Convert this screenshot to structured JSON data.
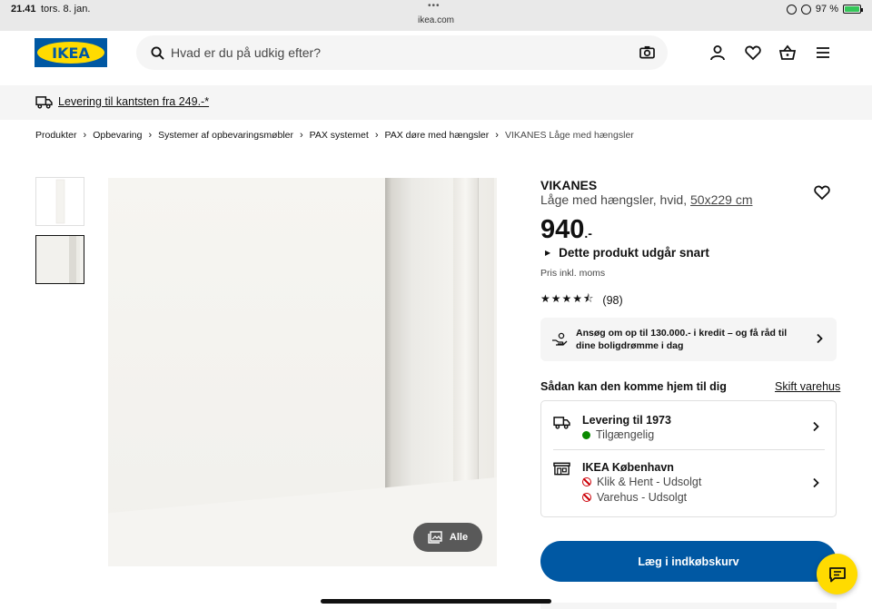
{
  "status_bar": {
    "time": "21.41",
    "date": "tors. 8. jan.",
    "url": "ikea.com",
    "battery": "97 %",
    "battery_level": 0.97
  },
  "header": {
    "logo_text": "IKEA",
    "search_placeholder": "Hvad er du på udkig efter?"
  },
  "banner": {
    "text": "Levering til kantsten fra 249.-*"
  },
  "breadcrumbs": [
    "Produkter",
    "Opbevaring",
    "Systemer af opbevaringsmøbler",
    "PAX systemet",
    "PAX døre med hængsler",
    "VIKANES Låge med hængsler"
  ],
  "gallery": {
    "all_button_label": "Alle"
  },
  "product": {
    "name": "VIKANES",
    "description": "Låge med hængsler, hvid,",
    "size": "50x229 cm",
    "price": "940",
    "price_suffix": ".-",
    "discontinued_note": "Dette produkt udgår snart",
    "vat_note": "Pris inkl. moms",
    "rating": 4.5,
    "rating_count": "(98)"
  },
  "credit": {
    "text": "Ansøg om op til 130.000.- i kredit – og få råd til dine boligdrømme i dag"
  },
  "delivery": {
    "title": "Sådan kan den komme hjem til dig",
    "change_store": "Skift varehus",
    "home_delivery": {
      "title": "Levering til 1973",
      "status": "Tilgængelig",
      "status_color": "#0a8a00"
    },
    "store": {
      "title": "IKEA København",
      "click_collect": "Klik & Hent - Udsolgt",
      "in_store": "Varehus - Udsolgt",
      "status_color": "#cc0008"
    }
  },
  "actions": {
    "add_to_cart": "Læg i indkøbskurv"
  },
  "colors": {
    "brand_blue": "#0058a3",
    "brand_yellow": "#ffdb00"
  }
}
